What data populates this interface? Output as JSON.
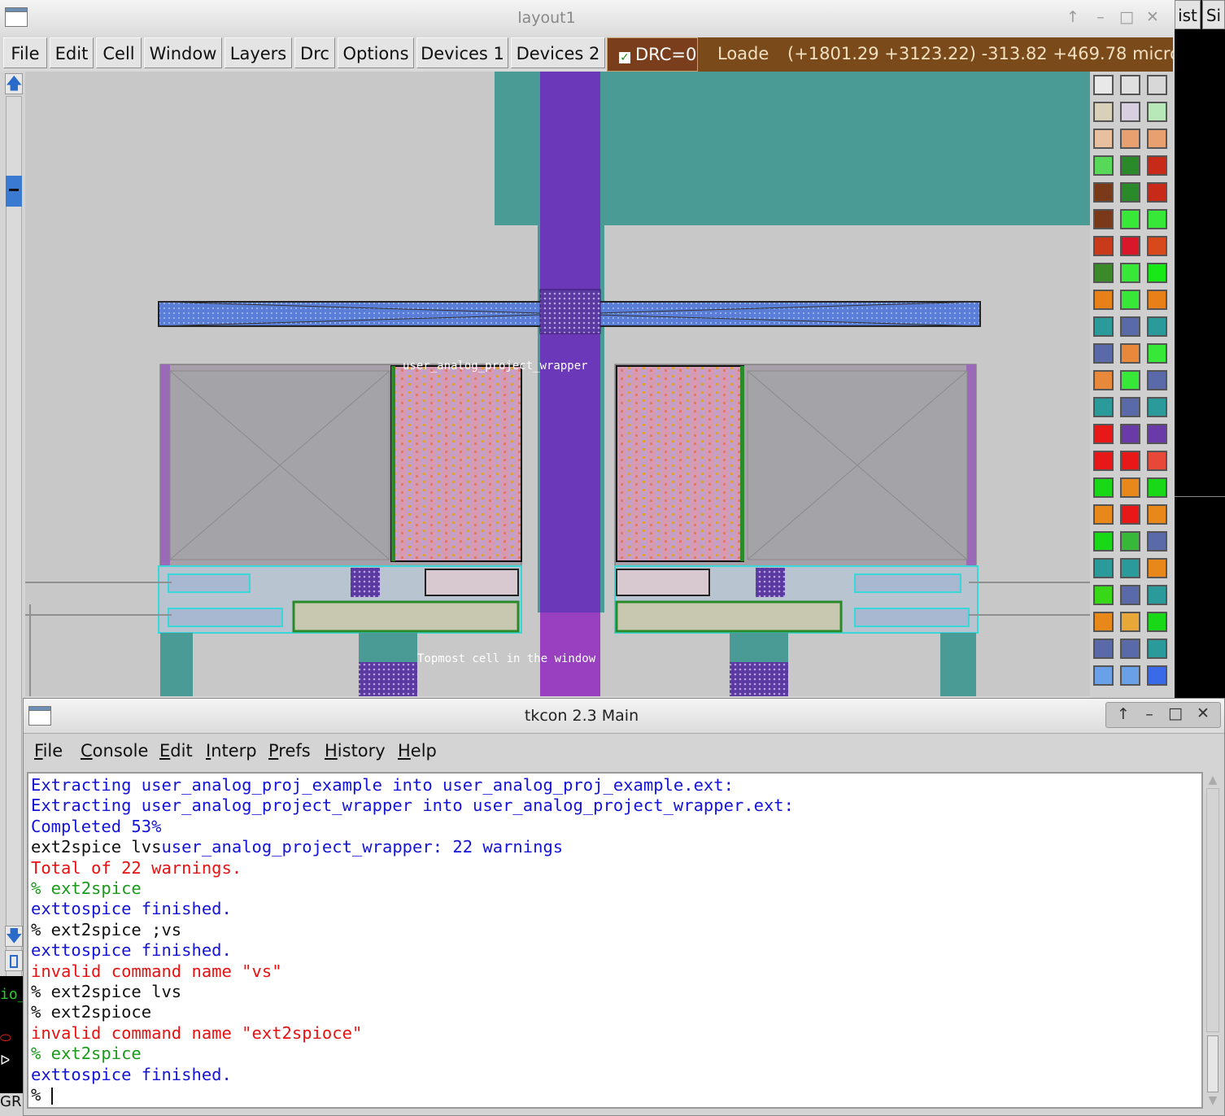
{
  "magic_window": {
    "title": "layout1",
    "menus": [
      "File",
      "Edit",
      "Cell",
      "Window",
      "Layers",
      "Drc",
      "Options",
      "Devices 1",
      "Devices 2"
    ],
    "drc_label": "DRC=0",
    "drc_checked": true,
    "status_loading": "Loade",
    "status_coords": "(+1801.29 +3123.22) -313.82 +469.78 microns"
  },
  "layout": {
    "cell_label": "user_analog_project_wrapper",
    "topmost_label": "Topmost cell in the window"
  },
  "right_tabs": [
    "ist",
    "Si"
  ],
  "left_partial": [
    "io_",
    "GR"
  ],
  "tkcon": {
    "title": "tkcon 2.3 Main",
    "menus": [
      {
        "key": "F",
        "rest": "ile"
      },
      {
        "key": "C",
        "rest": "onsole"
      },
      {
        "key": "E",
        "rest": "dit"
      },
      {
        "key": "I",
        "rest": "nterp"
      },
      {
        "key": "P",
        "rest": "refs"
      },
      {
        "key": "H",
        "rest": "istory"
      },
      {
        "key": "H",
        "rest": "elp"
      }
    ],
    "lines": [
      [
        {
          "text": "Extracting user_analog_proj_example into user_analog_proj_example.ext:",
          "color": "blue"
        }
      ],
      [
        {
          "text": "Extracting user_analog_project_wrapper into user_analog_project_wrapper.ext:",
          "color": "blue"
        }
      ],
      [
        {
          "text": "Completed 53%",
          "color": "blue"
        }
      ],
      [
        {
          "text": "ext2spice lvs",
          "color": "black"
        },
        {
          "text": "user_analog_project_wrapper: 22 warnings",
          "color": "blue"
        }
      ],
      [
        {
          "text": "Total of 22 warnings.",
          "color": "red"
        }
      ],
      [
        {
          "text": "% ext2spice",
          "color": "green"
        }
      ],
      [
        {
          "text": "exttospice finished.",
          "color": "blue"
        }
      ],
      [
        {
          "text": "% ext2spice ;vs",
          "color": "black"
        }
      ],
      [
        {
          "text": "exttospice finished.",
          "color": "blue"
        }
      ],
      [
        {
          "text": "invalid command name \"vs\"",
          "color": "red"
        }
      ],
      [
        {
          "text": "% ext2spice lvs",
          "color": "black"
        }
      ],
      [
        {
          "text": "% ext2spioce",
          "color": "black"
        }
      ],
      [
        {
          "text": "invalid command name \"ext2spioce\"",
          "color": "red"
        }
      ],
      [
        {
          "text": "% ext2spice",
          "color": "green"
        }
      ],
      [
        {
          "text": "exttospice finished.",
          "color": "blue"
        }
      ],
      [
        {
          "text": "% ",
          "color": "black"
        }
      ]
    ]
  },
  "colors": {
    "teal": "#4a9a96",
    "purple": "#6a38b8",
    "status_brown": "#7b4a1b",
    "console_blue": "#1414d8",
    "console_red": "#e81010",
    "console_green": "#1a9a1a"
  }
}
